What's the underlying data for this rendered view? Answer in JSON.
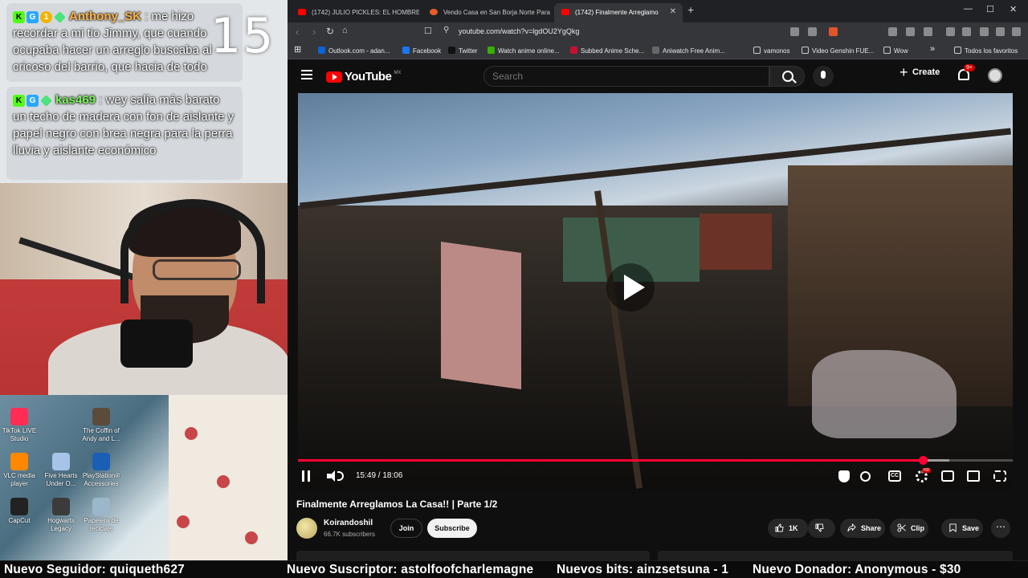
{
  "stream_overlay": {
    "big_number": "15",
    "chat": [
      {
        "user": "Anthony_SK",
        "user_color": "#ffb347",
        "message": "me hizo recordar a mi tio Jimmy, que cuando ocupaba hacer un arreglo buscaba al cricoso del barrio, que hacia de todo"
      },
      {
        "user": "kas469",
        "user_color": "#7cf25c",
        "message": "wey salía más barato un techo de madera con fon de aislante y papel negro con brea negra para la perra lluvia y aislante económico"
      }
    ],
    "desktop_icons": [
      {
        "label": "TikTok LIVE Studio",
        "icon": "tiktok-icon",
        "color": "#ff2d55"
      },
      {
        "label": "The Coffin of Andy and L...",
        "icon": "game-icon",
        "color": "#5c4a3a"
      },
      {
        "label": "VLC media player",
        "icon": "vlc-icon",
        "color": "#ff8800"
      },
      {
        "label": "Five Hearts Under O...",
        "icon": "game-icon",
        "color": "#a7c4e8"
      },
      {
        "label": "PlayStation® Accessories",
        "icon": "playstation-icon",
        "color": "#1a5fb4"
      },
      {
        "label": "CapCut",
        "icon": "capcut-icon",
        "color": "#222222"
      },
      {
        "label": "Hogwarts Legacy",
        "icon": "game-icon",
        "color": "#3b3b3b"
      },
      {
        "label": "Papelera de reciclaje",
        "icon": "recycle-bin-icon",
        "color": "#9cb7c9"
      }
    ]
  },
  "browser": {
    "tabs": [
      {
        "title": "(1742) JULIO PICKLES: EL HOMBRE M",
        "favicon": "youtube-icon",
        "active": false
      },
      {
        "title": "Vendo Casa en San Borja Norte Para",
        "favicon": "page-icon",
        "active": false
      },
      {
        "title": "(1742) Finalmente Arreglamo",
        "favicon": "youtube-icon",
        "active": true
      }
    ],
    "new_tab_label": "+",
    "window_controls": {
      "minimize": "—",
      "maximize": "☐",
      "close": "✕"
    },
    "url": "youtube.com/watch?v=lgdOU2YgQkg",
    "bookmarks": [
      {
        "label": "Outlook.com - adan...",
        "color": "#0a64d8"
      },
      {
        "label": "Facebook",
        "color": "#1877f2"
      },
      {
        "label": "Twitter",
        "color": "#111111"
      },
      {
        "label": "Watch anime online...",
        "color": "#38b000"
      },
      {
        "label": "Subbed Anime Sche...",
        "color": "#c8102e"
      },
      {
        "label": "Aniwatch Free Anim...",
        "color": "#666666"
      },
      {
        "label": "vamonos",
        "color": "folder"
      },
      {
        "label": "Video Genshin FUE...",
        "color": "folder"
      },
      {
        "label": "Wow",
        "color": "folder"
      }
    ],
    "bookmarks_more": "»",
    "all_bookmarks": "Todos los favoritos"
  },
  "youtube": {
    "logo_text": "YouTube",
    "region": "MX",
    "search_placeholder": "Search",
    "create_label": "Create",
    "notifications_badge": "9+",
    "player": {
      "time_current": "15:49",
      "time_total": "18:06",
      "time_display": "15:49 / 18:06",
      "progress_fraction": 0.874,
      "buffer_fraction": 0.911,
      "settings_badge": "HD",
      "cc_label": "CC"
    },
    "video": {
      "title": "Finalmente Arreglamos La Casa!! | Parte 1/2",
      "channel": "Koirandoshil",
      "subscribers": "66.7K subscribers",
      "join_label": "Join",
      "subscribe_label": "Subscribe",
      "likes": "1K",
      "share_label": "Share",
      "clip_label": "Clip",
      "save_label": "Save",
      "more_label": "⋯"
    }
  },
  "ticker": {
    "follower": "Nuevo Seguidor: quiqueth627",
    "subscriber": "Nuevo Suscriptor: astolfoofcharlemagne",
    "bits": "Nuevos bits: ainzsetsuna - 1",
    "donor": "Nuevo Donador: Anonymous - $30"
  }
}
